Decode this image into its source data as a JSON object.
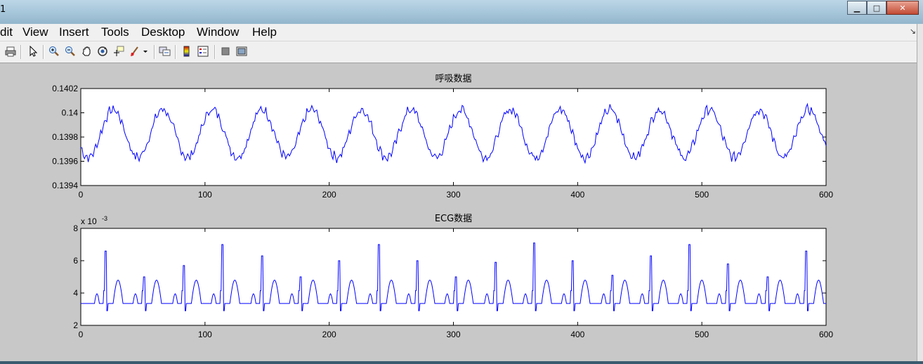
{
  "window": {
    "title_fragment": "1",
    "buttons": [
      "minimize",
      "maximize",
      "close"
    ]
  },
  "menu": [
    "dit",
    "View",
    "Insert",
    "Tools",
    "Desktop",
    "Window",
    "Help"
  ],
  "toolbar": {
    "icons": [
      "print-icon",
      "pointer-icon",
      "zoom-in-icon",
      "zoom-out-icon",
      "pan-icon",
      "rotate-icon",
      "data-cursor-icon",
      "brush-icon",
      "brush-dropdown-icon",
      "link-plot-icon",
      "colorbar-icon",
      "legend-icon",
      "hide-plot-tools-icon",
      "show-plot-tools-icon"
    ]
  },
  "chart_data": [
    {
      "type": "line",
      "title": "呼吸数据",
      "xlim": [
        0,
        600
      ],
      "ylim": [
        0.1394,
        0.1402
      ],
      "xticks": [
        0,
        100,
        200,
        300,
        400,
        500,
        600
      ],
      "yticks": [
        "0.1394",
        "0.1396",
        "0.1398",
        "0.14",
        "0.1402"
      ],
      "color": "#0000ff",
      "grid": false,
      "period": 40,
      "baseline": 0.13983,
      "amplitude": 0.00022,
      "noise": 3e-05,
      "peaks": [
        16,
        57,
        97,
        136,
        176,
        215,
        255,
        294,
        334,
        374,
        414,
        454,
        494,
        534,
        574
      ],
      "troughs": [
        5,
        38,
        77,
        117,
        157,
        196,
        236,
        276,
        315,
        354,
        394,
        434,
        474,
        514,
        554,
        594
      ]
    },
    {
      "type": "line",
      "title": "ECG数据",
      "exponent_label": "x 10",
      "exponent_power": "-3",
      "xlim": [
        0,
        600
      ],
      "ylim": [
        0.002,
        0.008
      ],
      "xticks": [
        0,
        100,
        200,
        300,
        400,
        500,
        600
      ],
      "yticks": [
        "2",
        "4",
        "6",
        "8"
      ],
      "color": "#0000ff",
      "grid": false,
      "baseline": 0.00335,
      "beat_positions": [
        20,
        51,
        83,
        114,
        146,
        177,
        208,
        240,
        271,
        302,
        334,
        365,
        396,
        428,
        459,
        490,
        521,
        553,
        584
      ],
      "r_peak_values": [
        0.0066,
        0.005,
        0.0057,
        0.007,
        0.0063,
        0.005,
        0.006,
        0.007,
        0.006,
        0.005,
        0.0059,
        0.0071,
        0.006,
        0.0051,
        0.0063,
        0.007,
        0.0058,
        0.005,
        0.0066
      ],
      "t_wave_value": 0.0048
    }
  ]
}
